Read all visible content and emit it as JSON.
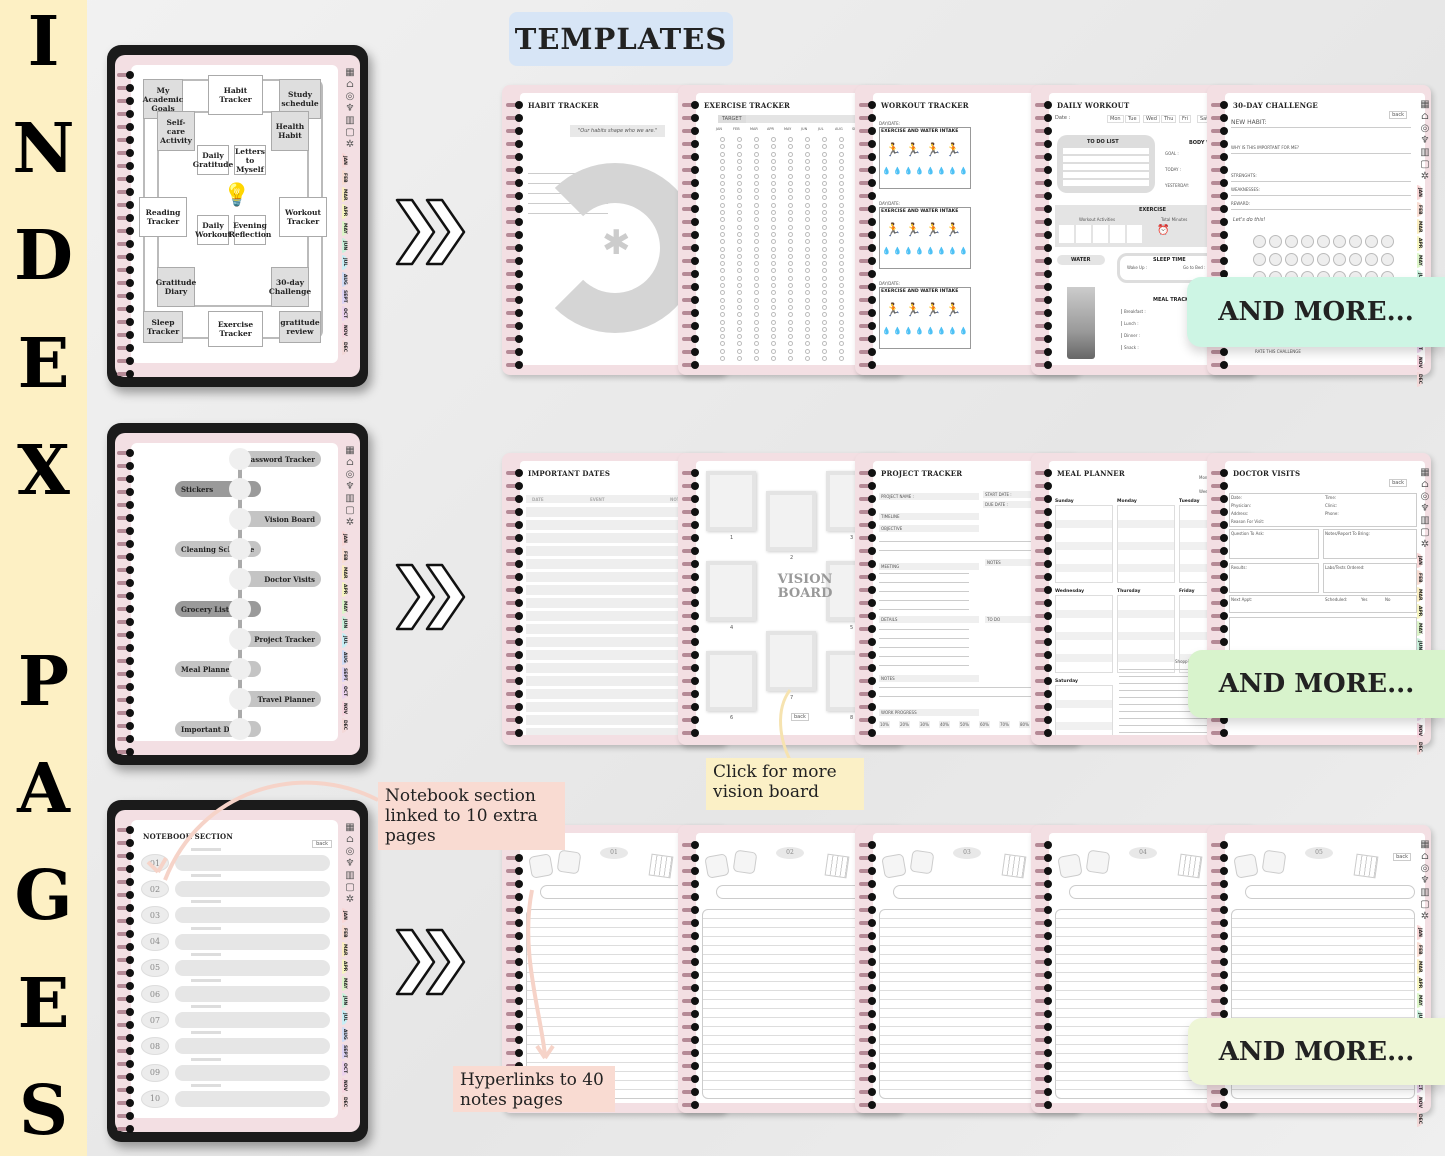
{
  "side_banner": {
    "letters": [
      "I",
      "N",
      "D",
      "E",
      "X",
      "P",
      "A",
      "G",
      "E",
      "S"
    ]
  },
  "templates_label": "TEMPLATES",
  "months": [
    "JAN",
    "FEB",
    "MAR",
    "APR",
    "MAY",
    "JUN",
    "JUL",
    "AUG",
    "SEPT",
    "OCT",
    "NOV",
    "DEC"
  ],
  "month_colors": [
    "#f8d6d6",
    "#f8dcd2",
    "#fbeec0",
    "#f6f5c0",
    "#dcf5c8",
    "#c9f1dc",
    "#c7eef5",
    "#cfdcf6",
    "#dcd3f5",
    "#ecd3ee",
    "#f6d3de",
    "#f3d8d8"
  ],
  "side_icons": [
    "calendar-icon",
    "home-icon",
    "target-icon",
    "trophy-icon",
    "chart-icon",
    "notes-icon",
    "settings-icon"
  ],
  "tablet1": {
    "labels": [
      "My Academic Goals",
      "Habit Tracker",
      "Study schedule",
      "Self-care Activity",
      "Health Habit",
      "Daily Gratitude",
      "Letters to Myself",
      "Reading Tracker",
      "Workout Tracker",
      "Daily Workout",
      "Evening Reflection",
      "Gratitude Diary",
      "30-day Challenge",
      "Sleep Tracker",
      "Exercise Tracker",
      "gratitude review"
    ]
  },
  "tablet2": {
    "items": [
      "Password Tracker",
      "Stickers",
      "Vision Board",
      "Cleaning Schedule",
      "Doctor Visits",
      "Grocery List",
      "Project Tracker",
      "Meal Planner",
      "Travel Planner",
      "Important Dates"
    ]
  },
  "tablet3": {
    "title": "NOTEBOOK SECTION",
    "back": "back",
    "numbers": [
      "01",
      "02",
      "03",
      "04",
      "05",
      "06",
      "07",
      "08",
      "09",
      "10"
    ]
  },
  "row1": [
    {
      "title": "HABIT TRACKER",
      "quote": "\"Our habits shape who we are.\""
    },
    {
      "title": "EXERCISE TRACKER",
      "target": "TARGET",
      "months": [
        "JAN",
        "FEB",
        "MAR",
        "APR",
        "MAY",
        "JUN",
        "JUL",
        "AUG",
        "SEP",
        "OCT"
      ]
    },
    {
      "title": "WORKOUT TRACKER",
      "day_date": "DAY/DATE:",
      "section": "EXERCISE AND WATER INTAKE"
    },
    {
      "title": "DAILY WORKOUT",
      "date": "Date :",
      "days": [
        "Mon",
        "Tue",
        "Wed",
        "Thu",
        "Fri",
        "Sat"
      ],
      "todo": "TO DO LIST",
      "body": "BODY WEIGHT",
      "body_rows": [
        "GOAL :",
        "TODAY :",
        "YESTERDAY:"
      ],
      "exercise": "EXERCISE",
      "activities": "Workout Activities",
      "minutes": "Total Minutes",
      "water": "WATER",
      "sleep": "SLEEP TIME",
      "wake": "Wake Up :",
      "bed": "Go to Bed :",
      "meal": "MEAL TRACKER",
      "meals": [
        "Breakfast :",
        "Lunch :",
        "Dinner :",
        "Snack :"
      ]
    },
    {
      "title": "30-DAY CHALLENGE",
      "back": "back",
      "rows": [
        "NEW HABIT:",
        "WHY IS THIS IMPORTANT FOR ME?",
        "STRENGHTS:",
        "WEAKNESSES:",
        "REWARD:"
      ],
      "script": "Let's do this!",
      "rate": "RATE THIS CHALLENGE"
    }
  ],
  "row2": [
    {
      "title": "IMPORTANT DATES",
      "cols": [
        "DATE",
        "EVENT",
        "NOTES"
      ]
    },
    {
      "title": "",
      "vision_text": "VISION BOARD",
      "frames": [
        "1",
        "2",
        "3",
        "4",
        "5",
        "6",
        "7",
        "8"
      ],
      "back": "back"
    },
    {
      "title": "PROJECT TRACKER",
      "fields": [
        "PROJECT NAME :",
        "START DATE :",
        "DUE DATE :",
        "TIMELINE",
        "OBJECTIVE",
        "MEETING",
        "NOTES",
        "DETAILS",
        "TO DO",
        "NOTES",
        "WORK PROGRESS"
      ],
      "progress": [
        "10%",
        "20%",
        "30%",
        "40%",
        "50%",
        "60%",
        "70%",
        "80%"
      ]
    },
    {
      "title": "MEAL PLANNER",
      "month": "Month:",
      "week": "Week:",
      "days": [
        "Sunday",
        "Monday",
        "Tuesday",
        "Wednesday",
        "Thursday",
        "Friday",
        "Saturday"
      ],
      "shopping": "Shopping List"
    },
    {
      "title": "DOCTOR VISITS",
      "back": "back",
      "fields": [
        "Date:",
        "Time:",
        "Physician:",
        "Clinic:",
        "Address:",
        "Phone:",
        "Reason For Visit:",
        "Question To Ask:",
        "Notes/Report To Bring:",
        "Results:",
        "Labs/Tests Ordered:",
        "Next Appt:",
        "Scheduled:",
        "Yes",
        "No"
      ]
    }
  ],
  "row3": [
    {
      "num": "01"
    },
    {
      "num": "02"
    },
    {
      "num": "03"
    },
    {
      "num": "04"
    },
    {
      "num": "05",
      "back": "back"
    }
  ],
  "and_more": [
    "AND MORE...",
    "AND MORE...",
    "AND MORE..."
  ],
  "and_more_colors": [
    "#cdf5e4",
    "#d8f3cc",
    "#eef6d6"
  ],
  "callouts": {
    "notebook": "Notebook section linked to 10 extra pages",
    "vision": "Click for more vision board",
    "hyperlinks": "Hyperlinks to 40 notes pages"
  }
}
